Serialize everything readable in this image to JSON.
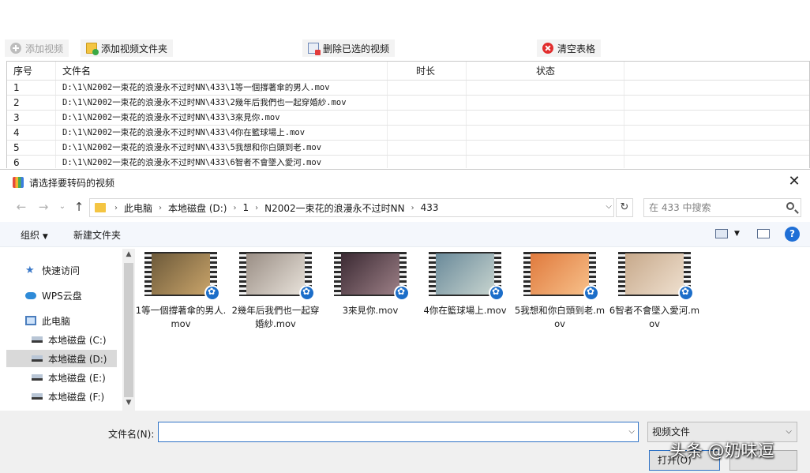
{
  "toolbar": {
    "add_video": "添加视频",
    "add_folder": "添加视频文件夹",
    "delete_selected": "删除已选的视频",
    "clear_table": "清空表格"
  },
  "table": {
    "headers": [
      "序号",
      "文件名",
      "时长",
      "状态"
    ],
    "rows": [
      {
        "index": "1",
        "file": "D:\\1\\N2002一束花的浪漫永不过时NN\\433\\1等一個撐著傘的男人.mov"
      },
      {
        "index": "2",
        "file": "D:\\1\\N2002一束花的浪漫永不过时NN\\433\\2幾年后我們也一起穿婚紗.mov"
      },
      {
        "index": "3",
        "file": "D:\\1\\N2002一束花的浪漫永不过时NN\\433\\3來見你.mov"
      },
      {
        "index": "4",
        "file": "D:\\1\\N2002一束花的浪漫永不过时NN\\433\\4你在籃球場上.mov"
      },
      {
        "index": "5",
        "file": "D:\\1\\N2002一束花的浪漫永不过时NN\\433\\5我想和你白頭到老.mov"
      },
      {
        "index": "6",
        "file": "D:\\1\\N2002一束花的浪漫永不过时NN\\433\\6智者不會墜入愛河.mov"
      }
    ]
  },
  "dialog": {
    "title": "请选择要转码的视频",
    "breadcrumbs": [
      "此电脑",
      "本地磁盘 (D:)",
      "1",
      "N2002一束花的浪漫永不过时NN",
      "433"
    ],
    "search_placeholder": "在 433 中搜索",
    "organize": "组织",
    "new_folder": "新建文件夹",
    "nav": {
      "quick_access": "快速访问",
      "wps_cloud": "WPS云盘",
      "this_pc": "此电脑",
      "drive_c": "本地磁盘 (C:)",
      "drive_d": "本地磁盘 (D:)",
      "drive_e": "本地磁盘 (E:)",
      "drive_f": "本地磁盘 (F:)"
    },
    "files": [
      {
        "name": "1等一個撐著傘的男人.mov",
        "colors": [
          "#6d5a3a",
          "#c9a46a"
        ]
      },
      {
        "name": "2幾年后我們也一起穿婚紗.mov",
        "colors": [
          "#9a8e85",
          "#e8e2da"
        ]
      },
      {
        "name": "3來見你.mov",
        "colors": [
          "#3b2a33",
          "#9c7f86"
        ]
      },
      {
        "name": "4你在籃球場上.mov",
        "colors": [
          "#6a8a9a",
          "#c7d4cf"
        ]
      },
      {
        "name": "5我想和你白頭到老.mov",
        "colors": [
          "#e07a3d",
          "#f7c08a"
        ]
      },
      {
        "name": "6智者不會墜入愛河.mov",
        "colors": [
          "#c7a98b",
          "#efe0cf"
        ]
      }
    ],
    "filename_label": "文件名(N):",
    "filename_value": "",
    "file_type": "视频文件",
    "open_button": "打开(O)"
  },
  "watermark": "头条 @奶味逗"
}
